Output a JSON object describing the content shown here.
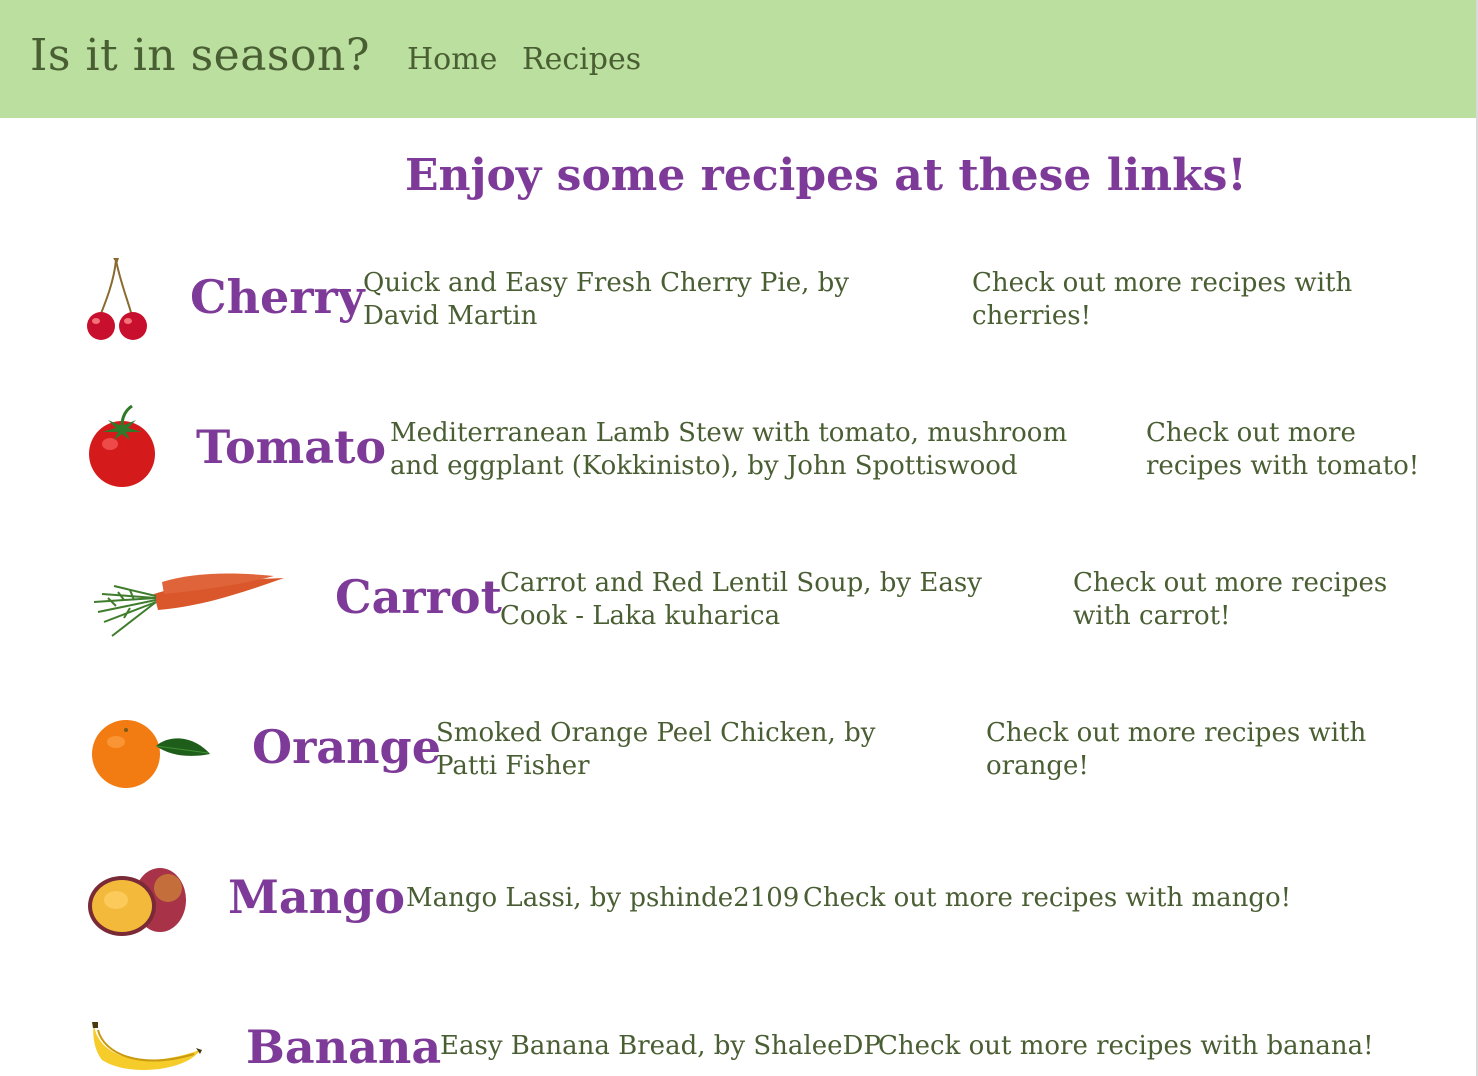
{
  "nav": {
    "brand": "Is it in season?",
    "links": [
      "Home",
      "Recipes"
    ]
  },
  "heading": "Enjoy some recipes at these links!",
  "fruits": [
    {
      "name": "Cherry",
      "recipe": "Quick and Easy Fresh Cherry Pie, by David Martin",
      "more": "Check out more recipes with cherries!",
      "image": "cherry-image"
    },
    {
      "name": "Tomato",
      "recipe": "Mediterranean Lamb Stew with tomato, mushroom and eggplant (Kokkinisto), by John Spottiswood",
      "more": "Check out more recipes with tomato!",
      "image": "tomato-image"
    },
    {
      "name": "Carrot",
      "recipe": "Carrot and Red Lentil Soup, by Easy Cook - Laka kuharica",
      "more": "Check out more recipes with carrot!",
      "image": "carrot-image"
    },
    {
      "name": "Orange",
      "recipe": "Smoked Orange Peel Chicken, by Patti Fisher",
      "more": "Check out more recipes with orange!",
      "image": "orange-image"
    },
    {
      "name": "Mango",
      "recipe": "Mango Lassi, by pshinde2109",
      "more": "Check out more recipes with mango!",
      "image": "mango-image"
    },
    {
      "name": "Banana",
      "recipe": "Easy Banana Bread, by ShaleeDP",
      "more": "Check out more recipes with banana!",
      "image": "banana-image"
    }
  ],
  "colors": {
    "navbar": "#badf9e",
    "nav_text": "#4a5e33",
    "accent": "#7e3a98",
    "link": "#4a5e33"
  }
}
